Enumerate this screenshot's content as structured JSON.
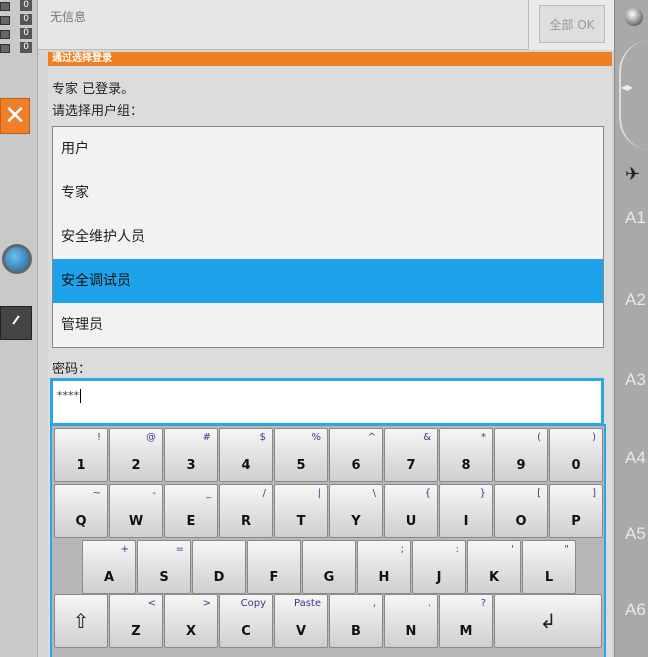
{
  "messages": {
    "text": "无信息",
    "ack_all_label": "全部 OK"
  },
  "left_rail": {
    "counters": [
      "0",
      "0",
      "0",
      "0"
    ]
  },
  "right_rail": {
    "axes": [
      "A1",
      "A2",
      "A3",
      "A4",
      "A5",
      "A6"
    ]
  },
  "dialog": {
    "title": "通过选择登录",
    "logged_in_text": "专家 已登录。",
    "choose_group_label": "请选择用户组：",
    "groups": [
      "用户",
      "专家",
      "安全维护人员",
      "安全调试员",
      "管理员"
    ],
    "selected_group": "安全调试员",
    "password_label": "密码：",
    "password_value": "****"
  },
  "keyboard": {
    "row1": [
      {
        "main": "1",
        "shift": "!"
      },
      {
        "main": "2",
        "shift": "@"
      },
      {
        "main": "3",
        "shift": "#"
      },
      {
        "main": "4",
        "shift": "$"
      },
      {
        "main": "5",
        "shift": "%"
      },
      {
        "main": "6",
        "shift": "^"
      },
      {
        "main": "7",
        "shift": "&"
      },
      {
        "main": "8",
        "shift": "*"
      },
      {
        "main": "9",
        "shift": "("
      },
      {
        "main": "0",
        "shift": ")"
      }
    ],
    "row2": [
      {
        "main": "Q",
        "shift": "~"
      },
      {
        "main": "W",
        "shift": "-"
      },
      {
        "main": "E",
        "shift": "_"
      },
      {
        "main": "R",
        "shift": "/"
      },
      {
        "main": "T",
        "shift": "|"
      },
      {
        "main": "Y",
        "shift": "\\"
      },
      {
        "main": "U",
        "shift": "{"
      },
      {
        "main": "I",
        "shift": "}"
      },
      {
        "main": "O",
        "shift": "["
      },
      {
        "main": "P",
        "shift": "]"
      }
    ],
    "row3": [
      {
        "main": "A",
        "shift": "+"
      },
      {
        "main": "S",
        "shift": "="
      },
      {
        "main": "D",
        "shift": ""
      },
      {
        "main": "F",
        "shift": ""
      },
      {
        "main": "G",
        "shift": ""
      },
      {
        "main": "H",
        "shift": ";"
      },
      {
        "main": "J",
        "shift": ":"
      },
      {
        "main": "K",
        "shift": "'"
      },
      {
        "main": "L",
        "shift": "\""
      }
    ],
    "row4": [
      {
        "main": "Z",
        "shift": "<"
      },
      {
        "main": "X",
        "shift": ">"
      },
      {
        "main": "C",
        "shift": "Copy"
      },
      {
        "main": "V",
        "shift": "Paste"
      },
      {
        "main": "B",
        "shift": ","
      },
      {
        "main": "N",
        "shift": "."
      },
      {
        "main": "M",
        "shift": "?"
      }
    ]
  }
}
